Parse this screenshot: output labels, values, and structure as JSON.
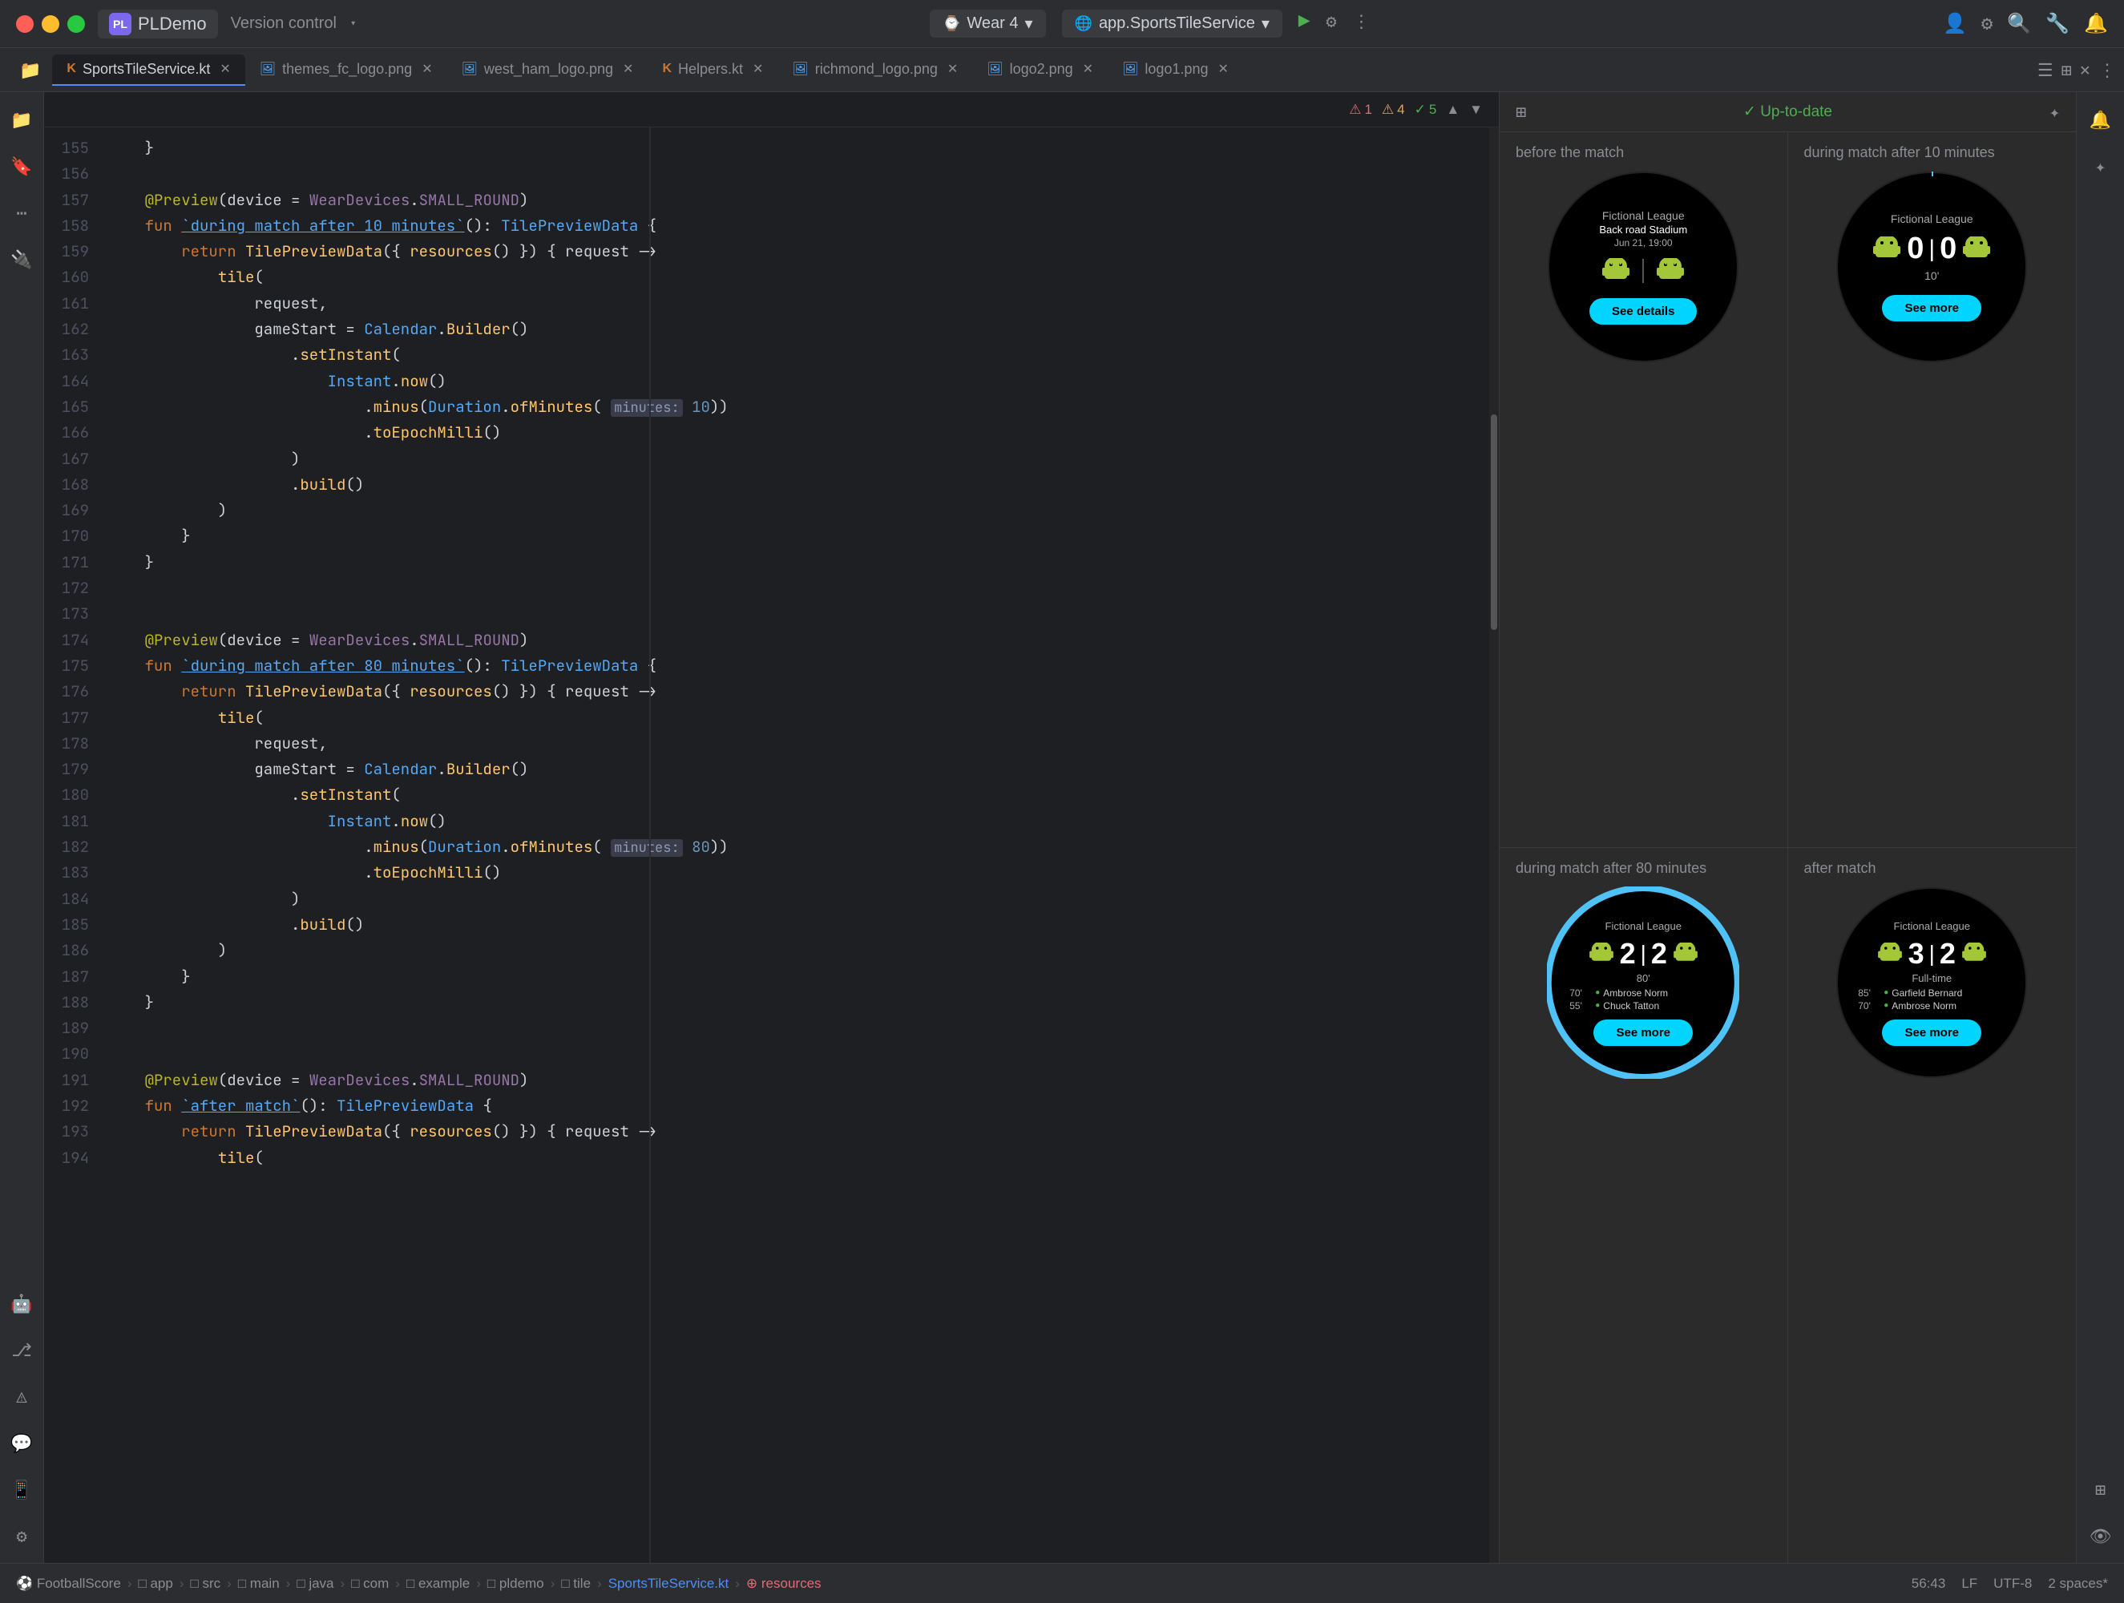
{
  "titlebar": {
    "app_name": "PLDemo",
    "version_control": "Version control",
    "wear_label": "Wear 4",
    "service_label": "app.SportsTileService",
    "chevron": "▾"
  },
  "tabs": [
    {
      "label": "SportsTileService.kt",
      "active": true,
      "icon": "kt"
    },
    {
      "label": "themes_fc_logo.png",
      "active": false,
      "icon": "img"
    },
    {
      "label": "west_ham_logo.png",
      "active": false,
      "icon": "img"
    },
    {
      "label": "Helpers.kt",
      "active": false,
      "icon": "kt"
    },
    {
      "label": "richmond_logo.png",
      "active": false,
      "icon": "img"
    },
    {
      "label": "logo2.png",
      "active": false,
      "icon": "img"
    },
    {
      "label": "logo1.png",
      "active": false,
      "icon": "img"
    }
  ],
  "editor": {
    "warnings": {
      "errors": "1",
      "warnings": "4",
      "info": "5"
    },
    "lines": [
      {
        "num": "155",
        "content": "    }"
      },
      {
        "num": "156",
        "content": ""
      },
      {
        "num": "157",
        "content": "    @Preview(device = WearDevices.SMALL_ROUND)"
      },
      {
        "num": "158",
        "content": "    fun `during match after 10 minutes`(): TilePreviewData {"
      },
      {
        "num": "159",
        "content": "        return TilePreviewData({ resources() }) { request ->"
      },
      {
        "num": "160",
        "content": "            tile("
      },
      {
        "num": "161",
        "content": "                request,"
      },
      {
        "num": "162",
        "content": "                gameStart = Calendar.Builder()"
      },
      {
        "num": "163",
        "content": "                    .setInstant("
      },
      {
        "num": "164",
        "content": "                        Instant.now()"
      },
      {
        "num": "165",
        "content": "                            .minus(Duration.ofMinutes( minutes: 10))"
      },
      {
        "num": "166",
        "content": "                            .toEpochMilli()"
      },
      {
        "num": "167",
        "content": "                    )"
      },
      {
        "num": "168",
        "content": "                    .build()"
      },
      {
        "num": "169",
        "content": "            )"
      },
      {
        "num": "170",
        "content": "        }"
      },
      {
        "num": "171",
        "content": "    }"
      },
      {
        "num": "172",
        "content": ""
      },
      {
        "num": "173",
        "content": ""
      },
      {
        "num": "174",
        "content": "    @Preview(device = WearDevices.SMALL_ROUND)"
      },
      {
        "num": "175",
        "content": "    fun `during match after 80 minutes`(): TilePreviewData {"
      },
      {
        "num": "176",
        "content": "        return TilePreviewData({ resources() }) { request ->"
      },
      {
        "num": "177",
        "content": "            tile("
      },
      {
        "num": "178",
        "content": "                request,"
      },
      {
        "num": "179",
        "content": "                gameStart = Calendar.Builder()"
      },
      {
        "num": "180",
        "content": "                    .setInstant("
      },
      {
        "num": "181",
        "content": "                        Instant.now()"
      },
      {
        "num": "182",
        "content": "                            .minus(Duration.ofMinutes( minutes: 80))"
      },
      {
        "num": "183",
        "content": "                            .toEpochMilli()"
      },
      {
        "num": "184",
        "content": "                    )"
      },
      {
        "num": "185",
        "content": "                    .build()"
      },
      {
        "num": "186",
        "content": "            )"
      },
      {
        "num": "187",
        "content": "        }"
      },
      {
        "num": "188",
        "content": "    }"
      },
      {
        "num": "189",
        "content": ""
      },
      {
        "num": "190",
        "content": ""
      },
      {
        "num": "191",
        "content": "    @Preview(device = WearDevices.SMALL_ROUND)"
      },
      {
        "num": "192",
        "content": "    fun `after match`(): TilePreviewData {"
      },
      {
        "num": "193",
        "content": "        return TilePreviewData({ resources() }) { request ->"
      },
      {
        "num": "194",
        "content": "            tile("
      }
    ]
  },
  "preview": {
    "up_to_date": "✓ Up-to-date",
    "panels": [
      {
        "label": "before the match",
        "league": "Fictional League",
        "venue": "Back road Stadium",
        "date": "Jun 21, 19:00",
        "score_left": "",
        "score_right": "",
        "button": "See details",
        "show_score": false
      },
      {
        "label": "during match after 10 minutes",
        "league": "Fictional League",
        "score_left": "0",
        "score_right": "0",
        "minute": "10'",
        "button": "See more",
        "show_score": true,
        "show_minute": true
      },
      {
        "label": "during match after 80 minutes",
        "league": "Fictional League",
        "score_left": "2",
        "score_right": "2",
        "minute": "80'",
        "button": "See more",
        "show_score": true,
        "show_minute": true,
        "scorers": [
          {
            "min": "70'",
            "name": "Ambrose Norm"
          },
          {
            "min": "55'",
            "name": "Chuck Tatton"
          }
        ]
      },
      {
        "label": "after match",
        "league": "Fictional League",
        "score_left": "3",
        "score_right": "2",
        "status": "Full-time",
        "button": "See more",
        "show_score": true,
        "show_fulltime": true,
        "scorers": [
          {
            "min": "85'",
            "name": "Garfield Bernard"
          },
          {
            "min": "70'",
            "name": "Ambrose Norm"
          }
        ]
      }
    ]
  },
  "status_bar": {
    "breadcrumbs": [
      "FootballScore",
      "app",
      "src",
      "main",
      "java",
      "com",
      "example",
      "pldemo",
      "tile",
      "SportsTileService.kt",
      "resources"
    ],
    "position": "56:43",
    "encoding": "LF",
    "charset": "UTF-8",
    "indent": "2 spaces*"
  }
}
